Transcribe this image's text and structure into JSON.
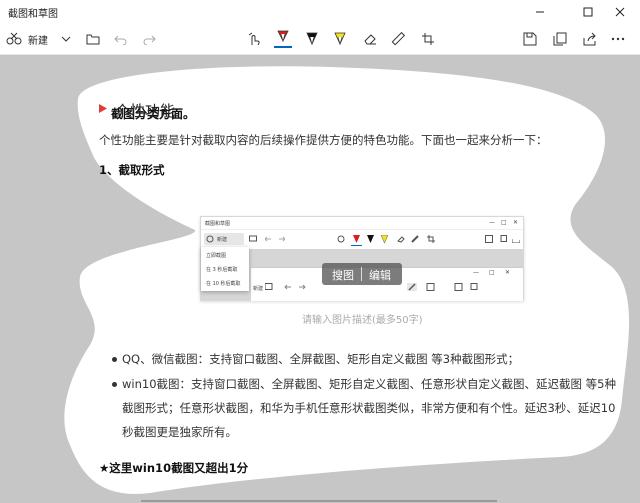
{
  "window": {
    "title": "截图和草图",
    "minimize_icon": "minimize-icon",
    "maximize_icon": "maximize-icon",
    "close_icon": "close-icon"
  },
  "toolbar": {
    "new_label": "新建",
    "tools": [
      "touch-writing-icon",
      "ballpoint-pen-icon",
      "pencil-icon",
      "highlighter-icon",
      "eraser-icon",
      "ruler-icon",
      "crop-icon"
    ],
    "right_tools": [
      "save-icon",
      "copy-icon",
      "share-icon",
      "more-icon"
    ],
    "accent_colors": {
      "pen": "#d81e1e",
      "pencil": "#111111",
      "highlighter": "#f5e31a",
      "active": "#0067c0"
    }
  },
  "document": {
    "cut_heading": "截图分类方面。",
    "section_title": "个性功能",
    "intro": "个性功能主要是针对截取内容的后续操作提供方便的特色功能。下面也一起来分析一下：",
    "sub_heading": "1、截取形式",
    "caption": "请输入图片描述(最多50字)",
    "bullets": [
      {
        "lines": [
          "QQ、微信截图：支持窗口截图、全屏截图、矩形自定义截图 等3种截图形式；"
        ]
      },
      {
        "lines": [
          "win10截图：支持窗口截图、全屏截图、矩形自定义截图、任意形状自定义截图、延迟截图 等5种",
          "截图形式；任意形状截图，和华为手机任意形状截图类似，非常方便和有个性。延迟3秒、延迟10",
          "秒截图更是独家所有。"
        ]
      }
    ],
    "footer_heading": "★这里win10截图又超出1分"
  },
  "embedded": {
    "app_title": "截图和草图",
    "new_label": "新建",
    "menu": [
      "立即截图",
      "在 3 秒后截取",
      "在 10 秒后截取"
    ],
    "overlay_buttons": [
      "搜图",
      "编辑"
    ]
  }
}
